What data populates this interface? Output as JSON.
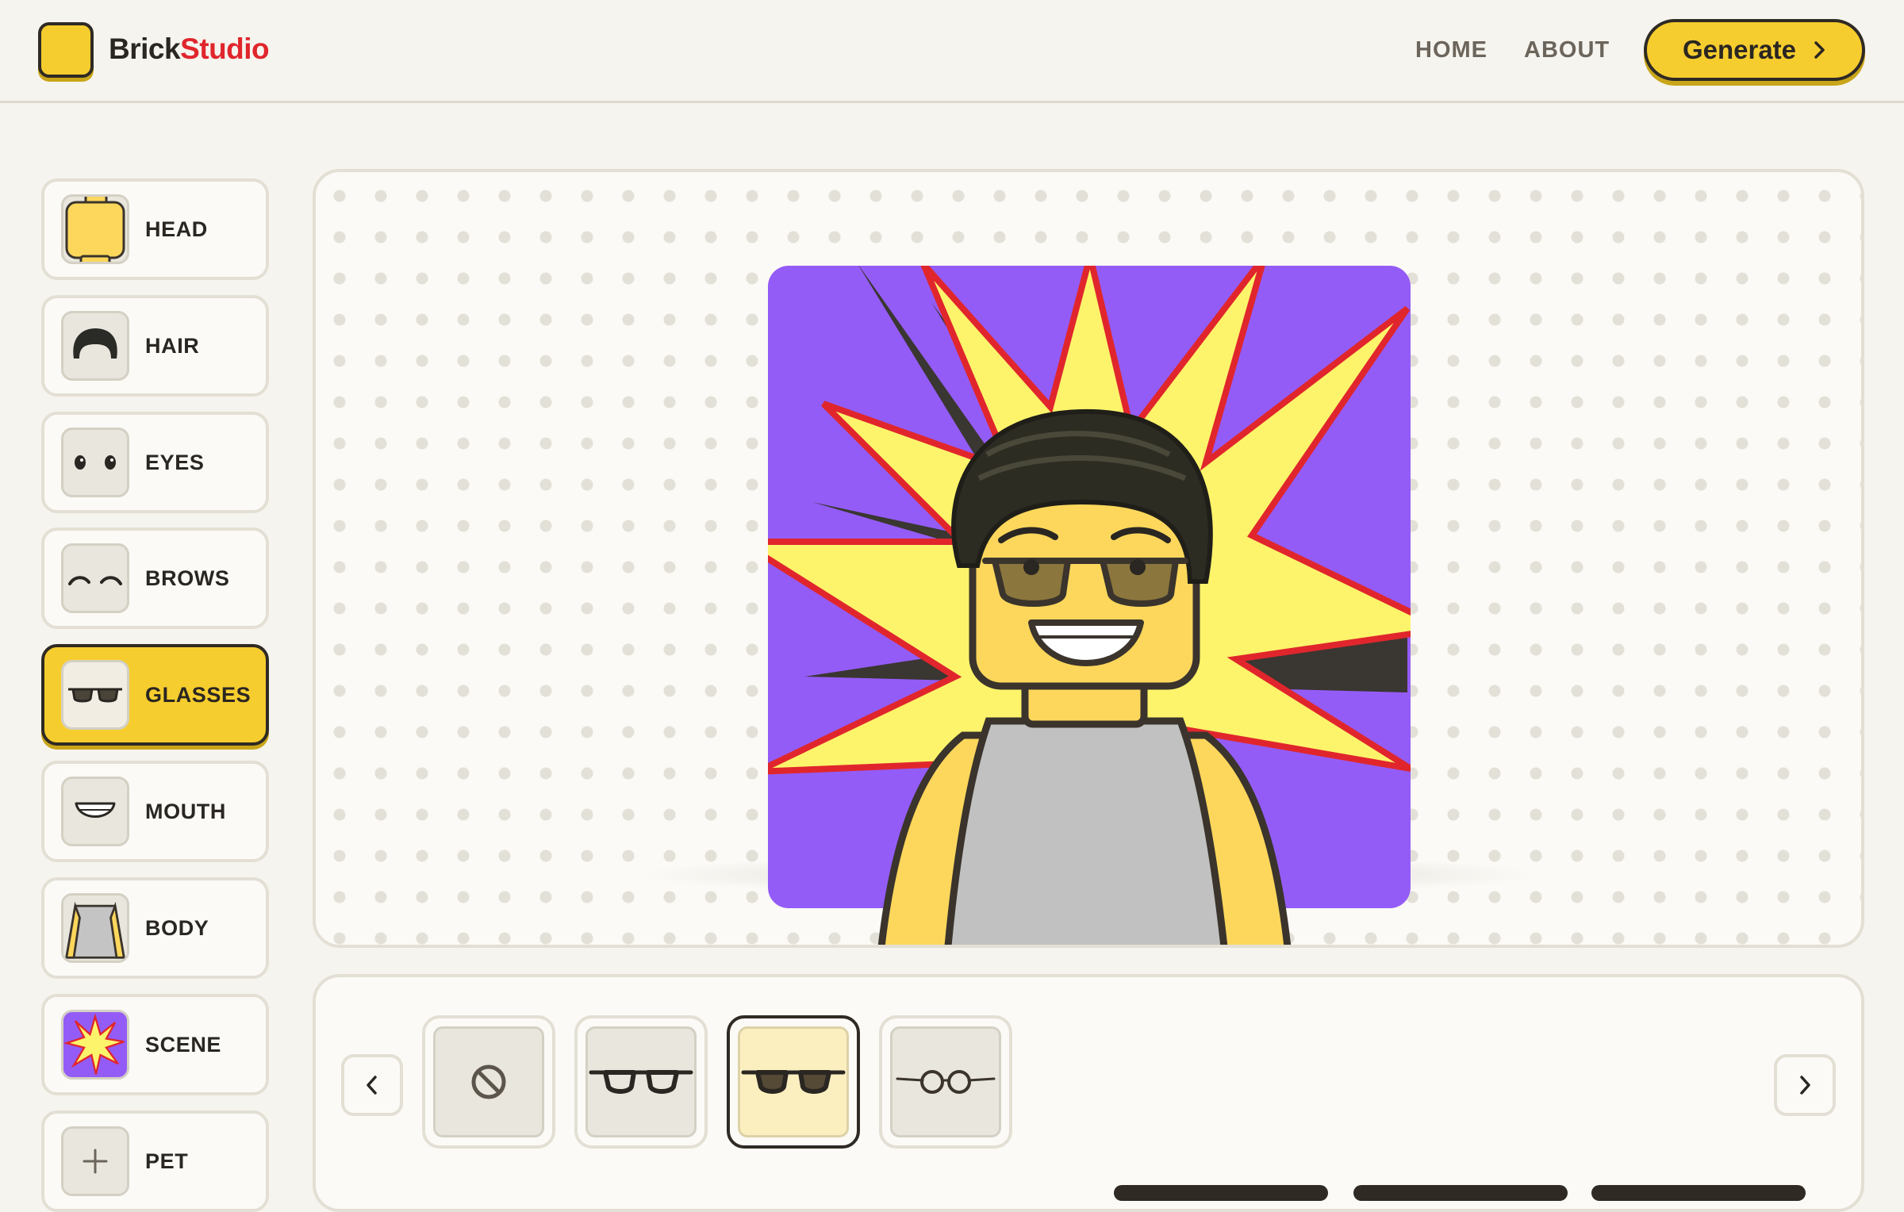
{
  "brand": {
    "name_part1": "Brick",
    "name_part2": "Studio"
  },
  "nav": {
    "home": "HOME",
    "about": "ABOUT"
  },
  "generate": {
    "label": "Generate"
  },
  "sidebar": {
    "items": [
      {
        "label": "HEAD",
        "icon": "head-icon"
      },
      {
        "label": "HAIR",
        "icon": "hair-icon"
      },
      {
        "label": "EYES",
        "icon": "eyes-icon"
      },
      {
        "label": "BROWS",
        "icon": "brows-icon"
      },
      {
        "label": "GLASSES",
        "icon": "glasses-icon",
        "active": true
      },
      {
        "label": "MOUTH",
        "icon": "mouth-icon"
      },
      {
        "label": "BODY",
        "icon": "body-icon"
      },
      {
        "label": "SCENE",
        "icon": "scene-icon"
      },
      {
        "label": "PET",
        "icon": "plus-icon"
      }
    ]
  },
  "options": {
    "items": [
      {
        "name": "none",
        "icon": "no-entry-icon"
      },
      {
        "name": "black-frame-glasses",
        "icon": "glasses-icon"
      },
      {
        "name": "sunglasses",
        "icon": "sunglasses-icon",
        "selected": true
      },
      {
        "name": "round-glasses",
        "icon": "round-glasses-icon"
      }
    ]
  },
  "colors": {
    "accent": "#f6cd2e",
    "brand_red": "#e0262c",
    "scene_purple": "#945cf6",
    "burst_yellow": "#fdf46b"
  }
}
